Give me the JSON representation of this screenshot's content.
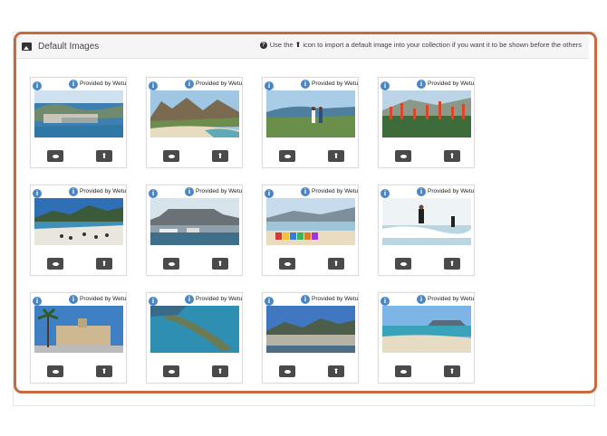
{
  "panel": {
    "title": "Default Images",
    "help_before": "Use the",
    "help_after": "icon to import a default image into your collection if you want it to be shown before the others"
  },
  "icons": {
    "panel": "image-icon",
    "help": "question-circle-icon",
    "help_arrow": "arrow-up-icon",
    "info": "info-icon",
    "view": "eye-icon",
    "import": "arrow-up-icon"
  },
  "colors": {
    "highlight_border": "#c8693f",
    "info": "#4a86c5",
    "button": "#4a4a4a"
  },
  "glyphs": {
    "info": "i",
    "up": "⬆",
    "q": "?"
  },
  "cards": [
    {
      "provided": "Provided by Wetu",
      "scene": "aerial-city-bay"
    },
    {
      "provided": "Provided by Wetu",
      "scene": "mountain-beach"
    },
    {
      "provided": "Provided by Wetu",
      "scene": "couple-coast"
    },
    {
      "provided": "Provided by Wetu",
      "scene": "aloe-flowers"
    },
    {
      "provided": "Provided by Wetu",
      "scene": "boulders-beach"
    },
    {
      "provided": "Provided by Wetu",
      "scene": "harbour-table-mountain"
    },
    {
      "provided": "Provided by Wetu",
      "scene": "beach-huts"
    },
    {
      "provided": "Provided by Wetu",
      "scene": "surfers"
    },
    {
      "provided": "Provided by Wetu",
      "scene": "city-hall-palms"
    },
    {
      "provided": "Provided by Wetu",
      "scene": "cape-point"
    },
    {
      "provided": "Provided by Wetu",
      "scene": "city-aerial-mountains"
    },
    {
      "provided": "Provided by Wetu",
      "scene": "table-mountain-beach"
    }
  ]
}
